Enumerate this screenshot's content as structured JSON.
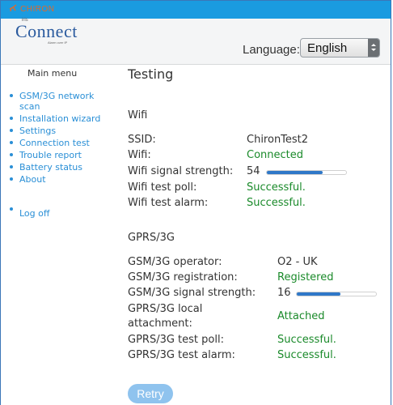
{
  "topbar": {
    "brand": "CHIRON"
  },
  "header": {
    "logo_small": "iris",
    "logo": "Connect",
    "logo_tag": "Alarm over IP",
    "language_label": "Language:",
    "language_value": "English"
  },
  "sidebar": {
    "title": "Main menu",
    "items": [
      {
        "label": "GSM/3G network scan"
      },
      {
        "label": "Installation wizard"
      },
      {
        "label": "Settings"
      },
      {
        "label": "Connection test"
      },
      {
        "label": "Trouble report"
      },
      {
        "label": "Battery status"
      },
      {
        "label": "About"
      }
    ],
    "logoff": "Log off"
  },
  "main": {
    "title": "Testing",
    "wifi": {
      "heading": "Wifi",
      "ssid_label": "SSID:",
      "ssid_value": "ChironTest2",
      "wifi_label": "Wifi:",
      "wifi_value": "Connected",
      "signal_label": "Wifi signal strength:",
      "signal_value": "54",
      "signal_fraction": 0.7,
      "poll_label": "Wifi test poll:",
      "poll_value": "Successful.",
      "alarm_label": "Wifi test alarm:",
      "alarm_value": "Successful."
    },
    "gprs": {
      "heading": "GPRS/3G",
      "operator_label": "GSM/3G operator:",
      "operator_value": "O2 - UK",
      "registration_label": "GSM/3G registration:",
      "registration_value": "Registered",
      "signal_label": "GSM/3G signal strength:",
      "signal_value": "16",
      "signal_fraction": 0.55,
      "local_label_1": "GPRS/3G local",
      "local_label_2": "attachment:",
      "local_value": "Attached",
      "poll_label": "GPRS/3G test poll:",
      "poll_value": "Successful.",
      "alarm_label": "GPRS/3G test alarm:",
      "alarm_value": "Successful."
    },
    "retry_label": "Retry"
  },
  "colors": {
    "topbar": "#1a9be0",
    "link": "#2a8fd6",
    "success": "#1a8a2a",
    "bar_fill": "#2f78c8",
    "retry": "#8fc3ee"
  }
}
